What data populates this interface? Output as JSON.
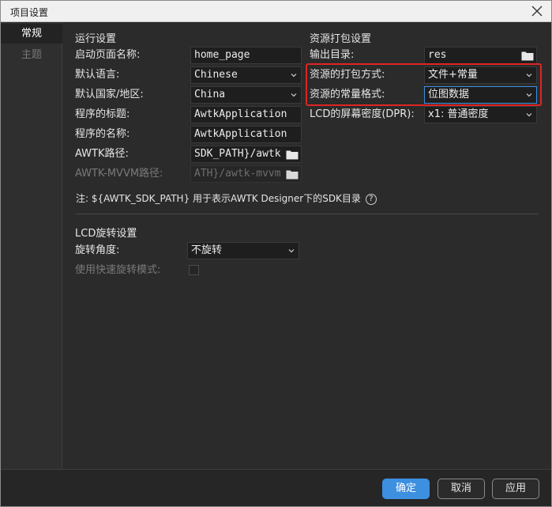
{
  "window": {
    "title": "项目设置"
  },
  "sidebar": {
    "items": [
      {
        "label": "常规",
        "active": true
      },
      {
        "label": "主题",
        "active": false
      }
    ]
  },
  "runtime": {
    "section_title": "运行设置",
    "start_page": {
      "label": "启动页面名称:",
      "value": "home_page"
    },
    "language": {
      "label": "默认语言:",
      "value": "Chinese"
    },
    "country": {
      "label": "默认国家/地区:",
      "value": "China"
    },
    "app_title": {
      "label": "程序的标题:",
      "value": "AwtkApplication"
    },
    "app_name": {
      "label": "程序的名称:",
      "value": "AwtkApplication"
    },
    "awtk_path": {
      "label": "AWTK路径:",
      "value": "SDK_PATH}/awtk"
    },
    "mvvm_path": {
      "label": "AWTK-MVVM路径:",
      "value": "ATH}/awtk-mvvm"
    }
  },
  "packaging": {
    "section_title": "资源打包设置",
    "output_dir": {
      "label": "输出目录:",
      "value": "res"
    },
    "pack_mode": {
      "label": "资源的打包方式:",
      "value": "文件+常量"
    },
    "const_format": {
      "label": "资源的常量格式:",
      "value": "位图数据"
    },
    "dpr": {
      "label": "LCD的屏幕密度(DPR):",
      "value": "x1: 普通密度"
    }
  },
  "note": {
    "text": "注: ${AWTK_SDK_PATH} 用于表示AWTK Designer下的SDK目录"
  },
  "lcd": {
    "section_title": "LCD旋转设置",
    "rotation": {
      "label": "旋转角度:",
      "value": "不旋转"
    },
    "fast_rotation": {
      "label": "使用快速旋转模式:"
    }
  },
  "footer": {
    "ok_label": "确定",
    "cancel_label": "取消",
    "apply_label": "应用"
  },
  "colors": {
    "accent": "#3d8fe0",
    "highlight": "#e02424",
    "background": "#2b2b2b"
  },
  "icons": {
    "close": "close-icon",
    "chevron": "chevron-down-icon",
    "folder": "folder-icon",
    "help": "help-icon"
  }
}
